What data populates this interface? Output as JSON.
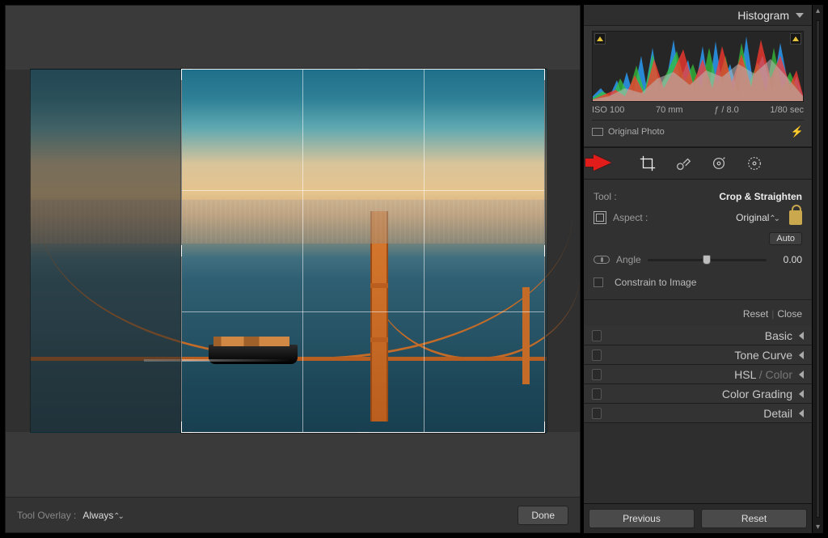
{
  "histogram": {
    "title": "Histogram",
    "iso": "ISO 100",
    "focal": "70 mm",
    "aperture": "ƒ / 8.0",
    "shutter": "1/80 sec",
    "original_label": "Original Photo"
  },
  "toolstrip": {
    "tools": [
      "crop",
      "spot",
      "redeye",
      "radial"
    ]
  },
  "tool_panel": {
    "tool_label": "Tool :",
    "tool_name": "Crop & Straighten",
    "aspect_label": "Aspect :",
    "aspect_value": "Original",
    "auto_label": "Auto",
    "angle_label": "Angle",
    "angle_value": "0.00",
    "angle_position_pct": 50,
    "constrain_label": "Constrain to Image",
    "reset": "Reset",
    "close": "Close"
  },
  "sections": {
    "basic": "Basic",
    "tone_curve": "Tone Curve",
    "hsl": "HSL",
    "color": "Color",
    "color_grading": "Color Grading",
    "detail": "Detail"
  },
  "bottom": {
    "previous": "Previous",
    "reset": "Reset"
  },
  "canvas_footer": {
    "tool_overlay_label": "Tool Overlay :",
    "tool_overlay_value": "Always",
    "done": "Done"
  }
}
